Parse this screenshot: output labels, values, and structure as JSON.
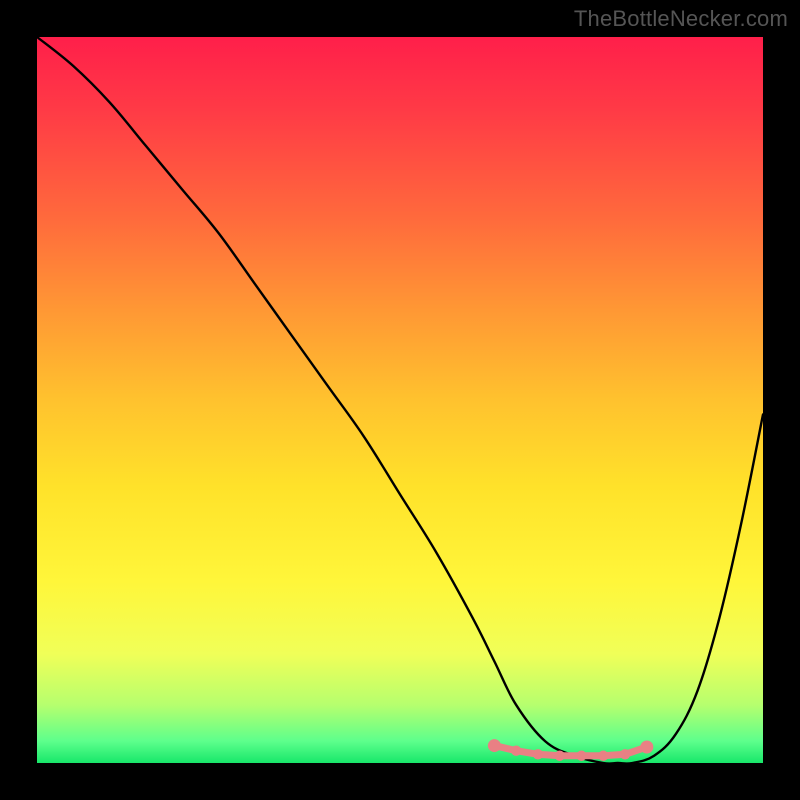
{
  "watermark": "TheBottleNecker.com",
  "colors": {
    "frame": "#000000",
    "curve": "#000000",
    "marker_fill": "#e98084",
    "marker_stroke": "#e98084"
  },
  "chart_data": {
    "type": "line",
    "title": "",
    "xlabel": "",
    "ylabel": "",
    "xlim": [
      0,
      100
    ],
    "ylim": [
      0,
      100
    ],
    "series": [
      {
        "name": "bottleneck-curve",
        "x": [
          0,
          5,
          10,
          15,
          20,
          25,
          30,
          35,
          40,
          45,
          50,
          55,
          60,
          63,
          66,
          70,
          74,
          78,
          80,
          82,
          85,
          88,
          91,
          94,
          97,
          100
        ],
        "values": [
          100,
          96,
          91,
          85,
          79,
          73,
          66,
          59,
          52,
          45,
          37,
          29,
          20,
          14,
          8,
          3,
          1,
          0,
          0,
          0,
          1,
          4,
          10,
          20,
          33,
          48
        ]
      }
    ],
    "markers": {
      "name": "flat-bottom-markers",
      "x": [
        63,
        66,
        69,
        72,
        75,
        78,
        81,
        84
      ],
      "values": [
        2.4,
        1.7,
        1.2,
        1.0,
        1.0,
        1.0,
        1.2,
        2.2
      ]
    }
  }
}
